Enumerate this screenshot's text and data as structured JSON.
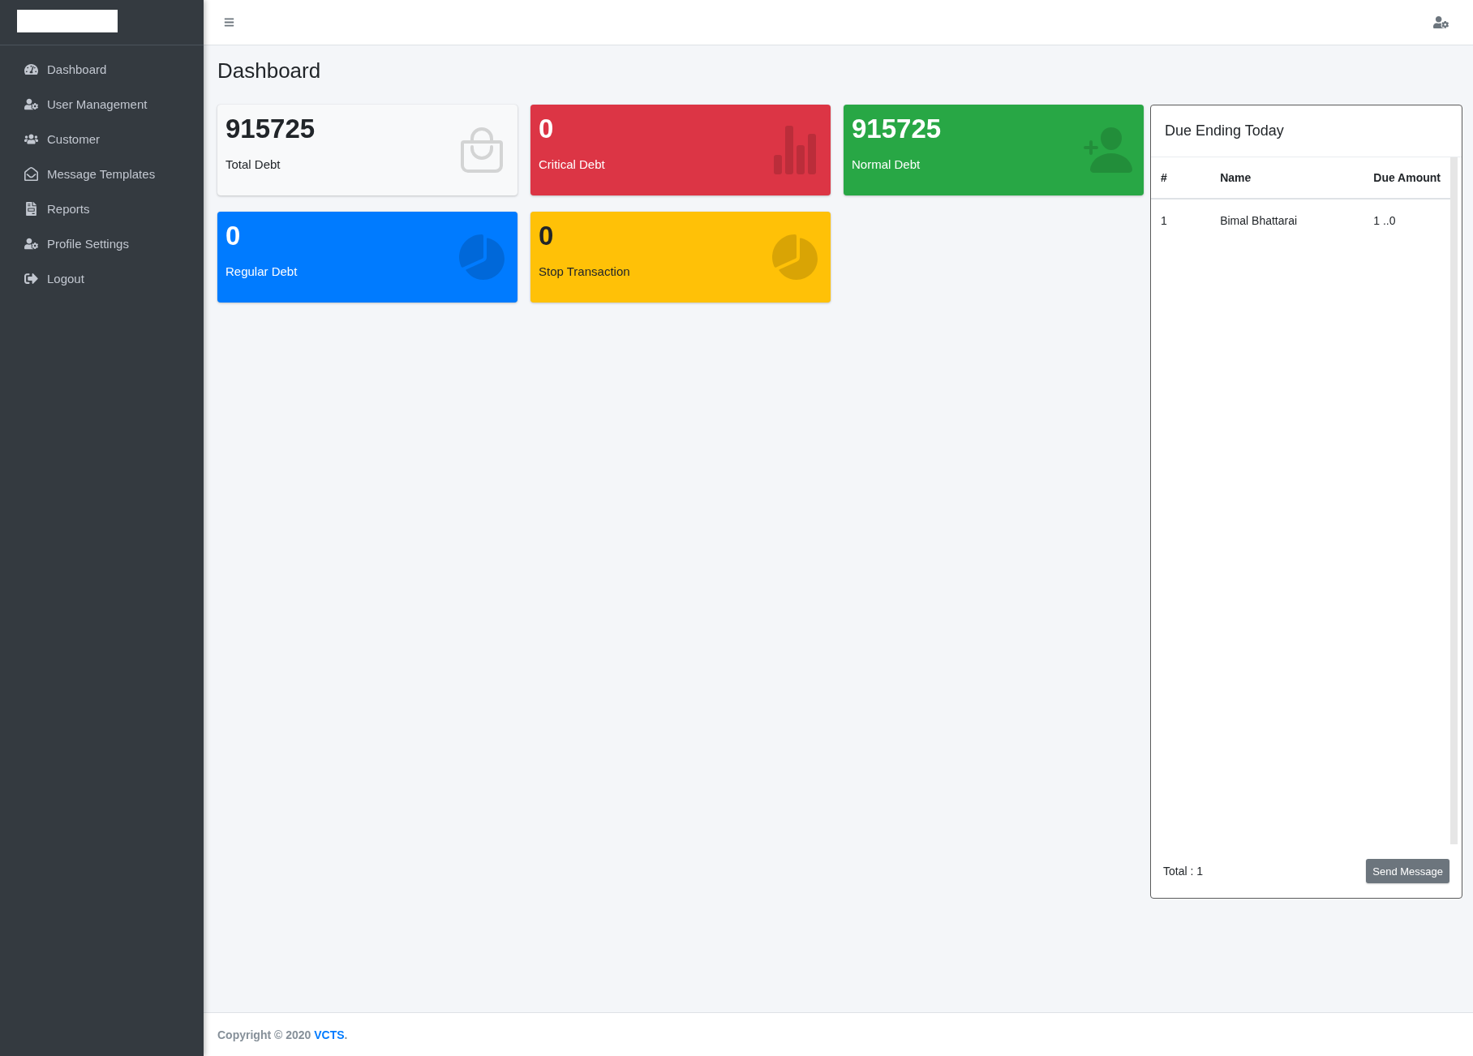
{
  "sidebar": {
    "items": [
      {
        "label": "Dashboard",
        "selected": false
      },
      {
        "label": "User Management",
        "selected": false
      },
      {
        "label": "Customer",
        "selected": false
      },
      {
        "label": "Message Templates",
        "selected": false
      },
      {
        "label": "Reports",
        "selected": false
      },
      {
        "label": "Profile Settings",
        "selected": false
      },
      {
        "label": "Logout",
        "selected": false
      }
    ]
  },
  "page_title": "Dashboard",
  "cards": [
    {
      "value": "915725",
      "label": "Total Debt",
      "color": "#f8f9fa"
    },
    {
      "value": "0",
      "label": "Critical Debt",
      "color": "#dc3545"
    },
    {
      "value": "915725",
      "label": "Normal Debt",
      "color": "#28a745"
    },
    {
      "value": "0",
      "label": "Regular Debt",
      "color": "#007bff"
    },
    {
      "value": "0",
      "label": "Stop Transaction",
      "color": "#ffc107"
    }
  ],
  "due_panel": {
    "title": "Due Ending Today",
    "table": {
      "columns": [
        "#",
        "Name",
        "Due Amount"
      ],
      "rows": [
        [
          "1",
          "Bimal Bhattarai",
          "1 ..0"
        ]
      ]
    },
    "total": "Total : 1",
    "button": "Send Message"
  },
  "footer": {
    "text": "Copyright © 2020",
    "link": "VCTS",
    "suffix": "."
  }
}
